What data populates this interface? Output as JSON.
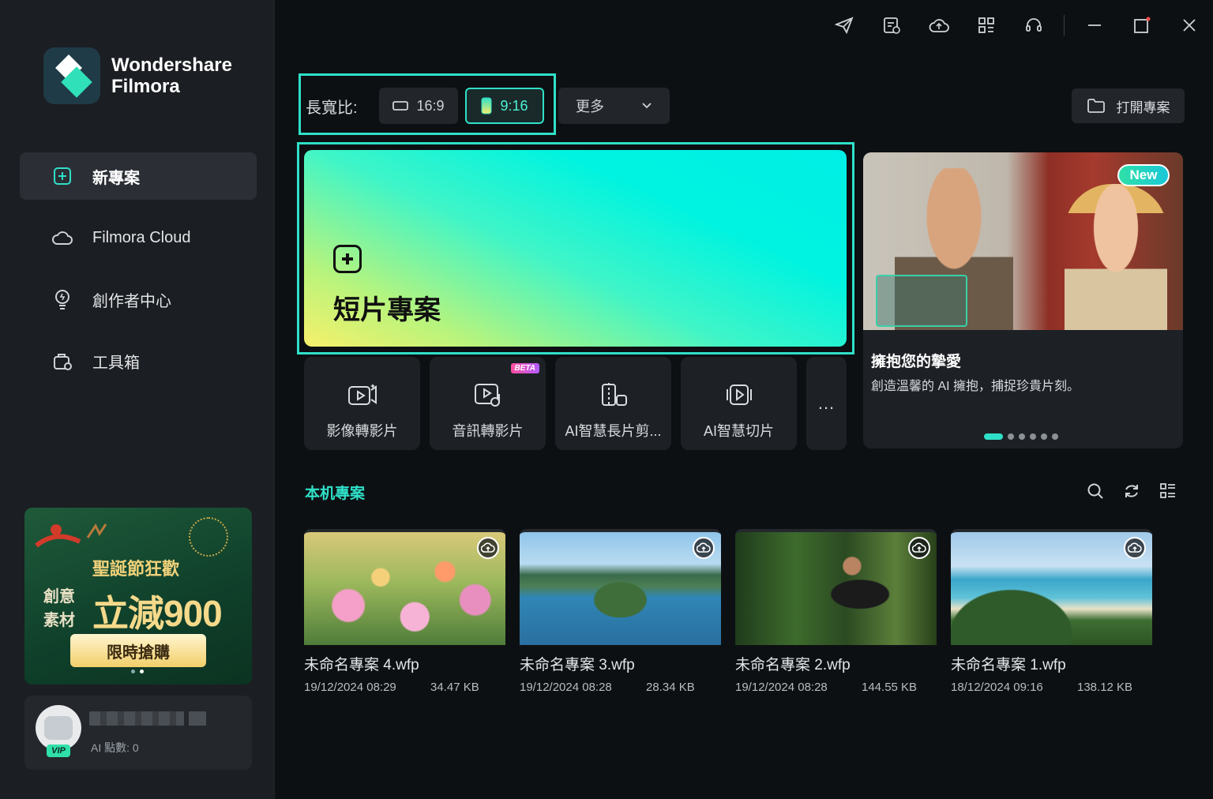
{
  "app": {
    "logo_line1": "Wondershare",
    "logo_line2": "Filmora"
  },
  "sidebar": {
    "items": [
      {
        "label": "新專案",
        "icon": "new-project-icon",
        "active": true
      },
      {
        "label": "Filmora Cloud",
        "icon": "cloud-icon",
        "active": false
      },
      {
        "label": "創作者中心",
        "icon": "lightbulb-icon",
        "active": false
      },
      {
        "label": "工具箱",
        "icon": "toolbox-icon",
        "active": false
      }
    ],
    "promo": {
      "headline": "聖誕節狂歡",
      "side_text": "創意素材",
      "big_text": "立減900",
      "button": "限時搶購"
    },
    "user": {
      "points": "AI 點數: 0",
      "badge": "VIP"
    }
  },
  "toolbar": {
    "icons": [
      "send-icon",
      "tasks-icon",
      "cloud-upload-icon",
      "apps-grid-icon",
      "headset-icon"
    ],
    "window_controls": [
      "minimize-icon",
      "maximize-icon",
      "close-icon"
    ]
  },
  "aspect": {
    "label": "長寬比:",
    "options": [
      {
        "label": "16:9",
        "selected": false
      },
      {
        "label": "9:16",
        "selected": true
      }
    ],
    "more_label": "更多",
    "open_project_label": "打開專案"
  },
  "hero": {
    "title": "短片專案"
  },
  "tools": [
    {
      "label": "影像轉影片",
      "icon": "image-to-video-icon",
      "beta": false
    },
    {
      "label": "音訊轉影片",
      "icon": "audio-to-video-icon",
      "beta": true,
      "beta_label": "BETA"
    },
    {
      "label": "AI智慧長片剪...",
      "icon": "long-video-cut-icon",
      "beta": false
    },
    {
      "label": "AI智慧切片",
      "icon": "smart-clip-icon",
      "beta": false
    }
  ],
  "tools_more": "...",
  "banner": {
    "badge": "New",
    "title": "擁抱您的摯愛",
    "subtitle": "創造溫馨的 AI 擁抱，捕捉珍貴片刻。",
    "slides": 6,
    "active_slide": 0
  },
  "local": {
    "title": "本机專案",
    "projects": [
      {
        "name": "未命名專案 4.wfp",
        "date": "19/12/2024 08:29",
        "size": "34.47 KB",
        "thumb": "flowers"
      },
      {
        "name": "未命名專案 3.wfp",
        "date": "19/12/2024 08:28",
        "size": "28.34 KB",
        "thumb": "lake"
      },
      {
        "name": "未命名專案 2.wfp",
        "date": "19/12/2024 08:28",
        "size": "144.55 KB",
        "thumb": "forest"
      },
      {
        "name": "未命名專案 1.wfp",
        "date": "18/12/2024 09:16",
        "size": "138.12 KB",
        "thumb": "beach"
      }
    ]
  },
  "colors": {
    "accent": "#2fe0c8",
    "sidebar_bg": "#1b1e22",
    "main_bg": "#0d1013"
  }
}
